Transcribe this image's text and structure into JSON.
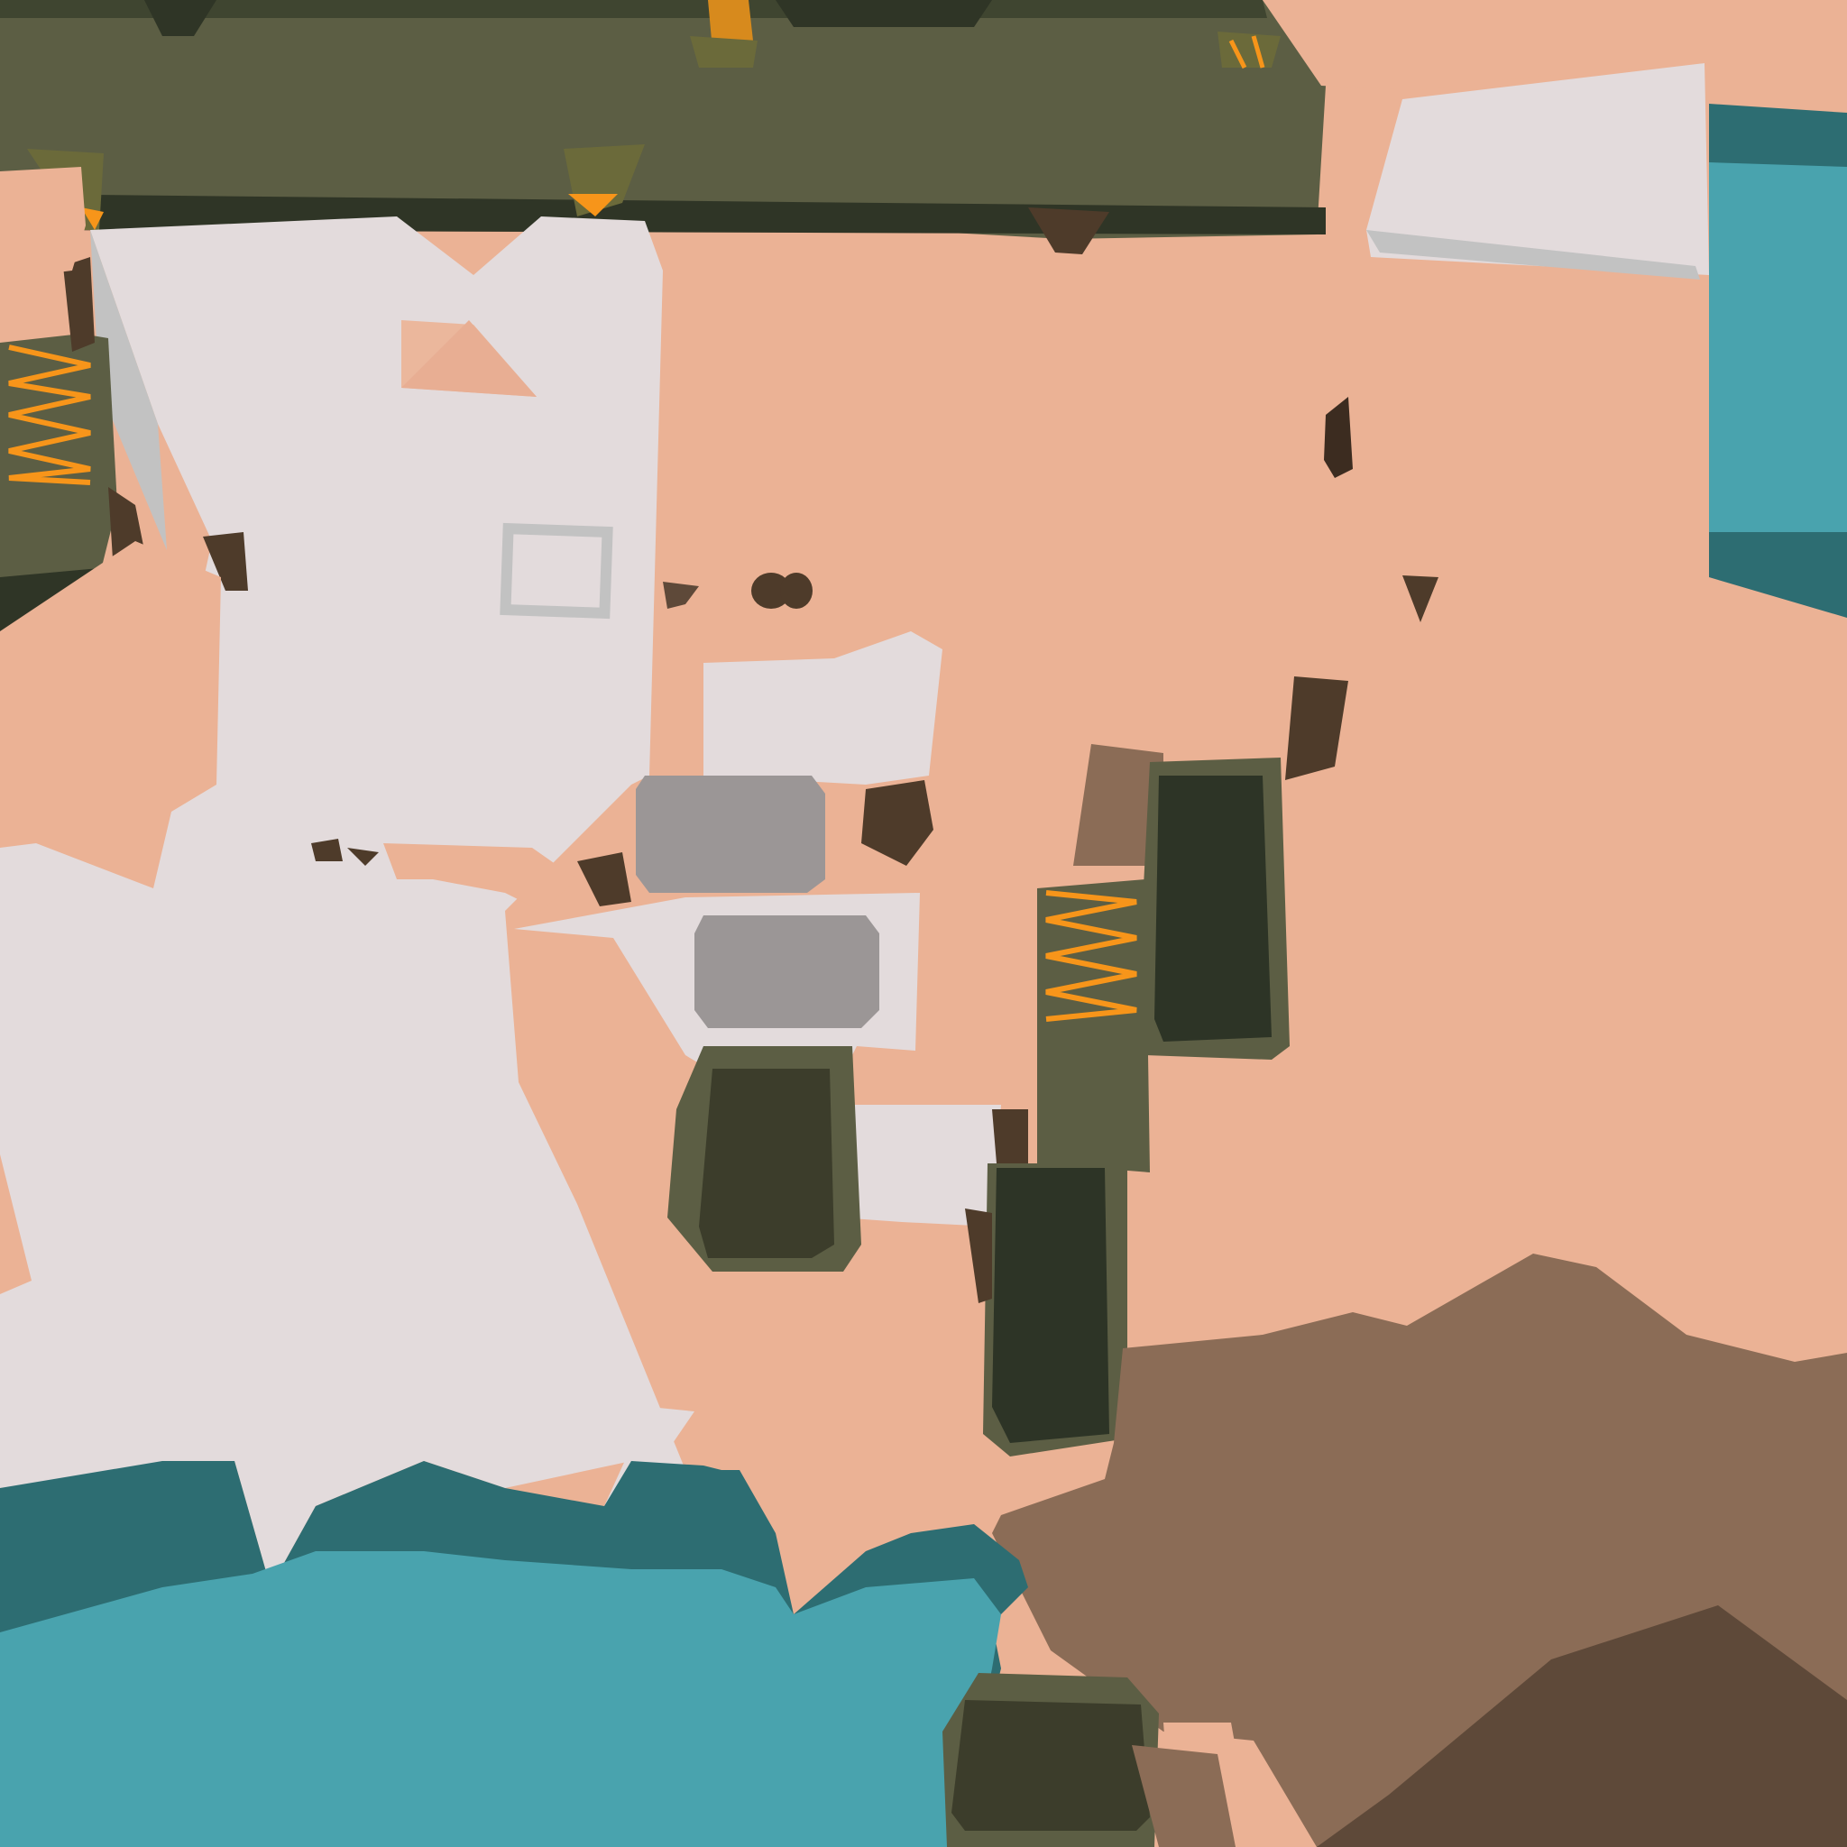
{
  "scene": {
    "description_visible_text": [],
    "palette": {
      "skin": "#EBB295",
      "shirt": "#E3DBDC",
      "grass": "#5C5E44",
      "grass_dark": "#2F3526",
      "boot": "#3C3D2B",
      "boot_dark": "#2D3426",
      "lace": "#F7951A",
      "water": "#49A3AE",
      "water_dark": "#2D6D72",
      "rock": "#8B6C56",
      "rock_dark": "#5E4939",
      "hair": "#4E3B2A",
      "stone": "#9B9696",
      "shadow_grey": "#C2C2C2"
    },
    "icons": [
      "boot-icon",
      "lace-icon",
      "stone-icon",
      "badge-square-icon"
    ]
  }
}
